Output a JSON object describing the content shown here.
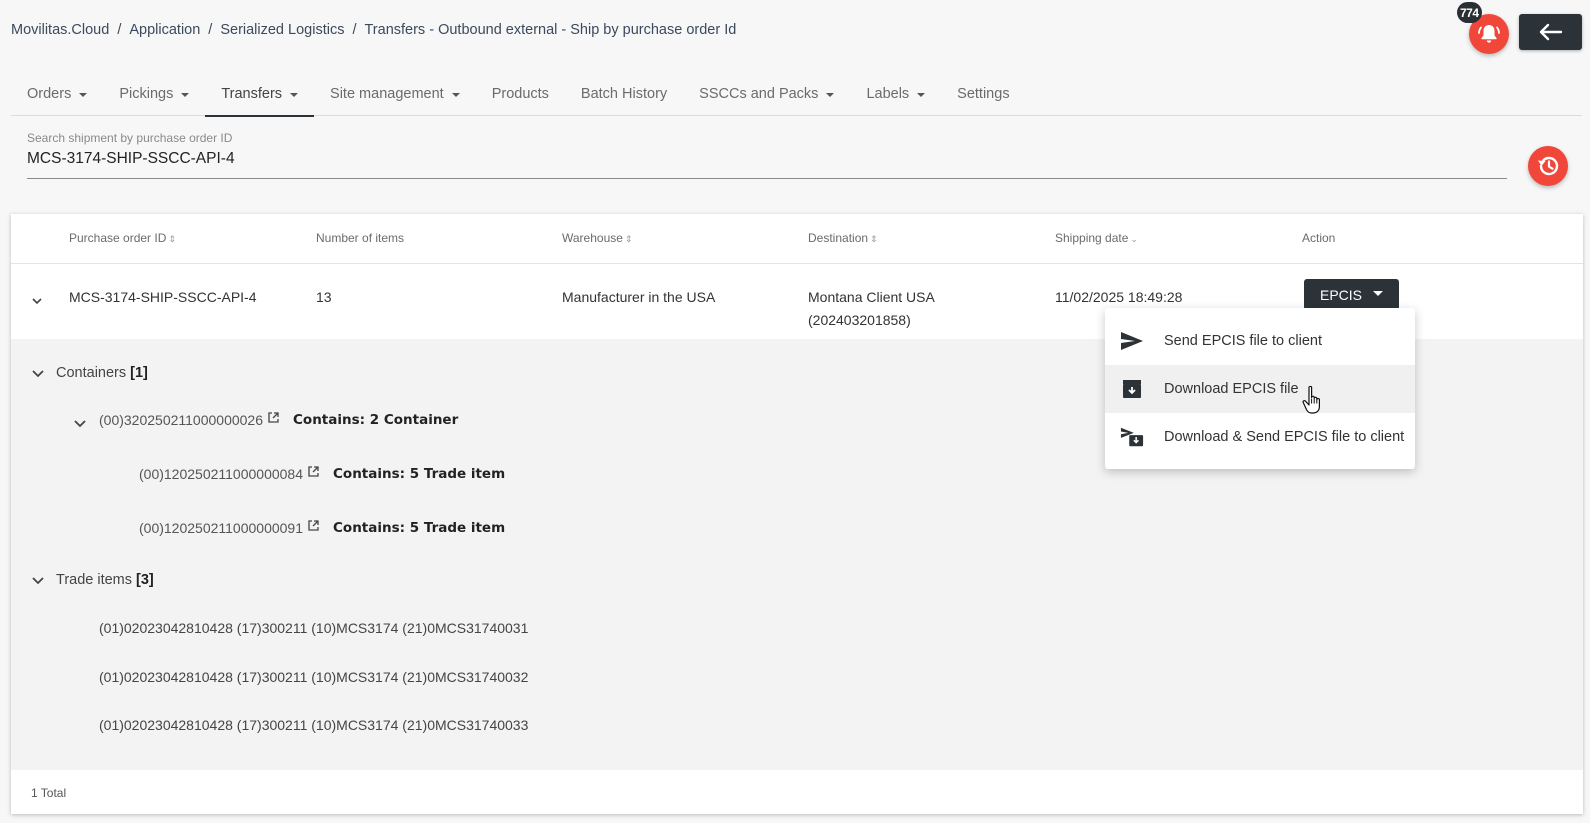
{
  "breadcrumb": {
    "items": [
      "Movilitas.Cloud",
      "Application",
      "Serialized Logistics",
      "Transfers - Outbound external - Ship by purchase order Id"
    ],
    "separator": "/"
  },
  "notifications": {
    "count": "774",
    "icon": "bell-icon"
  },
  "back_button": {
    "icon": "arrow-left-icon"
  },
  "tabs": [
    {
      "label": "Orders",
      "dropdown": true
    },
    {
      "label": "Pickings",
      "dropdown": true
    },
    {
      "label": "Transfers",
      "dropdown": true,
      "active": true
    },
    {
      "label": "Site management",
      "dropdown": true
    },
    {
      "label": "Products",
      "dropdown": false
    },
    {
      "label": "Batch History",
      "dropdown": false
    },
    {
      "label": "SSCCs and Packs",
      "dropdown": true
    },
    {
      "label": "Labels",
      "dropdown": true
    },
    {
      "label": "Settings",
      "dropdown": false
    }
  ],
  "search": {
    "label": "Search shipment by purchase order ID",
    "value": "MCS-3174-SHIP-SSCC-API-4"
  },
  "table": {
    "headers": {
      "purchase_order_id": "Purchase order ID",
      "number_of_items": "Number of items",
      "warehouse": "Warehouse",
      "destination": "Destination",
      "shipping_date": "Shipping date",
      "action": "Action"
    },
    "row": {
      "purchase_order_id": "MCS-3174-SHIP-SSCC-API-4",
      "number_of_items": "13",
      "warehouse": "Manufacturer in the USA",
      "destination_line1": "Montana Client USA",
      "destination_line2": "(202403201858)",
      "shipping_date": "11/02/2025 18:49:28",
      "action_label": "EPCIS"
    },
    "footer_total": "1 Total"
  },
  "detail": {
    "containers": {
      "label": "Containers",
      "count": "[1]",
      "parent": {
        "code": "(00)320250211000000026",
        "contains": "Contains: 2 Container"
      },
      "children": [
        {
          "code": "(00)120250211000000084",
          "contains": "Contains: 5 Trade item"
        },
        {
          "code": "(00)120250211000000091",
          "contains": "Contains: 5 Trade item"
        }
      ]
    },
    "trade_items": {
      "label": "Trade items",
      "count": "[3]",
      "items": [
        "(01)02023042810428 (17)300211 (10)MCS3174 (21)0MCS31740031",
        "(01)02023042810428 (17)300211 (10)MCS3174 (21)0MCS31740032",
        "(01)02023042810428 (17)300211 (10)MCS3174 (21)0MCS31740033"
      ]
    }
  },
  "epcis_menu": {
    "items": [
      {
        "label": "Send EPCIS file to client",
        "icon": "send-icon"
      },
      {
        "label": "Download EPCIS file",
        "icon": "archive-download-icon"
      },
      {
        "label": "Download & Send EPCIS file to client",
        "icon": "send-download-icon"
      }
    ]
  },
  "colors": {
    "accent_red": "#f0473a",
    "dark_button": "#2b3338",
    "detail_background": "#f3f3f3"
  }
}
